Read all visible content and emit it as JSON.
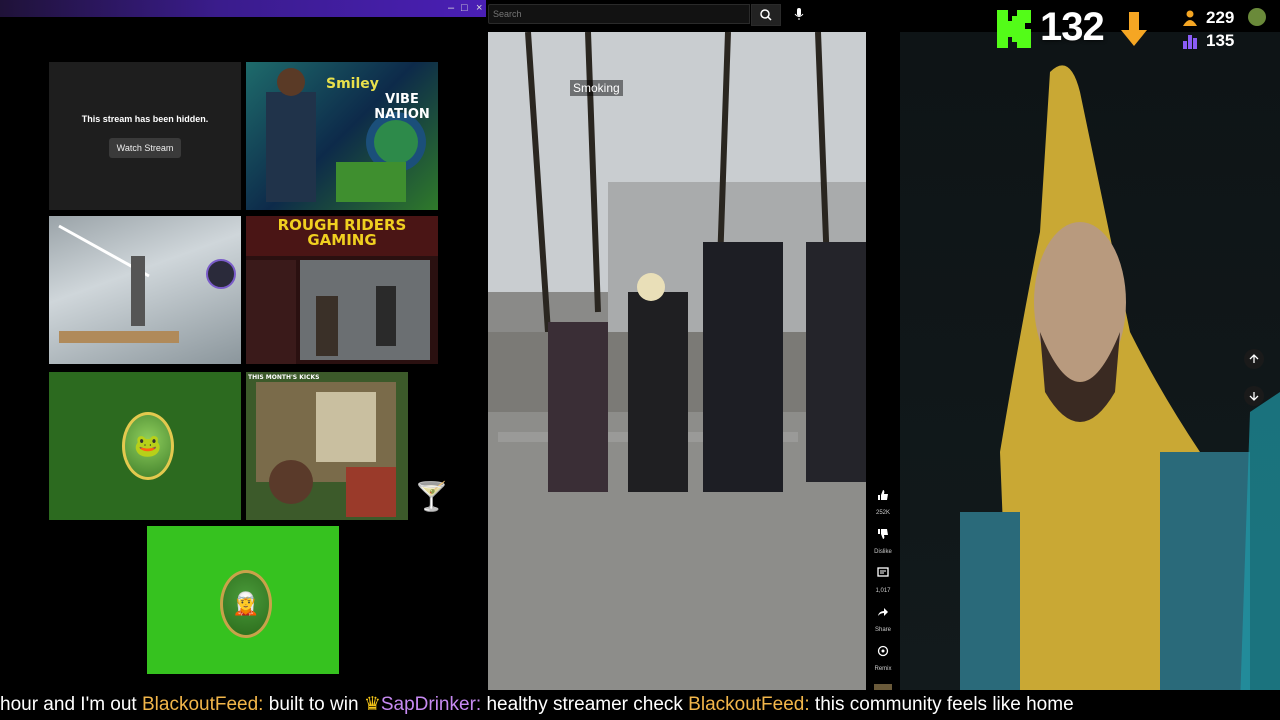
{
  "left_window": {
    "controls": [
      "–",
      "□",
      "×"
    ],
    "hidden_tile": {
      "message": "This stream has been hidden.",
      "button_label": "Watch Stream"
    },
    "thumb_vibe": {
      "title_a": "Smiley",
      "title_b": "VIBE NATION"
    },
    "thumb_rough": {
      "title": "ROUGH RIDERS GAMING"
    },
    "thumb_kicks": {
      "title": "THIS MONTH'S KICKS"
    }
  },
  "youtube": {
    "search_placeholder": "Search",
    "video_label": "Smoking",
    "actions": [
      {
        "icon": "thumbs-up-icon",
        "label": "252K"
      },
      {
        "icon": "thumbs-down-icon",
        "label": "Dislike"
      },
      {
        "icon": "comment-icon",
        "label": "1,017"
      },
      {
        "icon": "share-icon",
        "label": "Share"
      },
      {
        "icon": "remix-icon",
        "label": "Remix"
      }
    ]
  },
  "stats": {
    "viewers": "132",
    "stat_a": "229",
    "stat_b": "135",
    "colors": {
      "kick": "#53fc18",
      "down_arrow": "#f5a623",
      "stat_a": "#f5a623",
      "stat_b": "#8a5cf6"
    }
  },
  "ticker": {
    "m0": "hour and I'm out",
    "u1": "BlackoutFeed:",
    "m1": "built to win",
    "u2": "SapDrinker:",
    "m2": "healthy streamer check",
    "u3": "BlackoutFeed:",
    "m3": "this community feels like home"
  }
}
